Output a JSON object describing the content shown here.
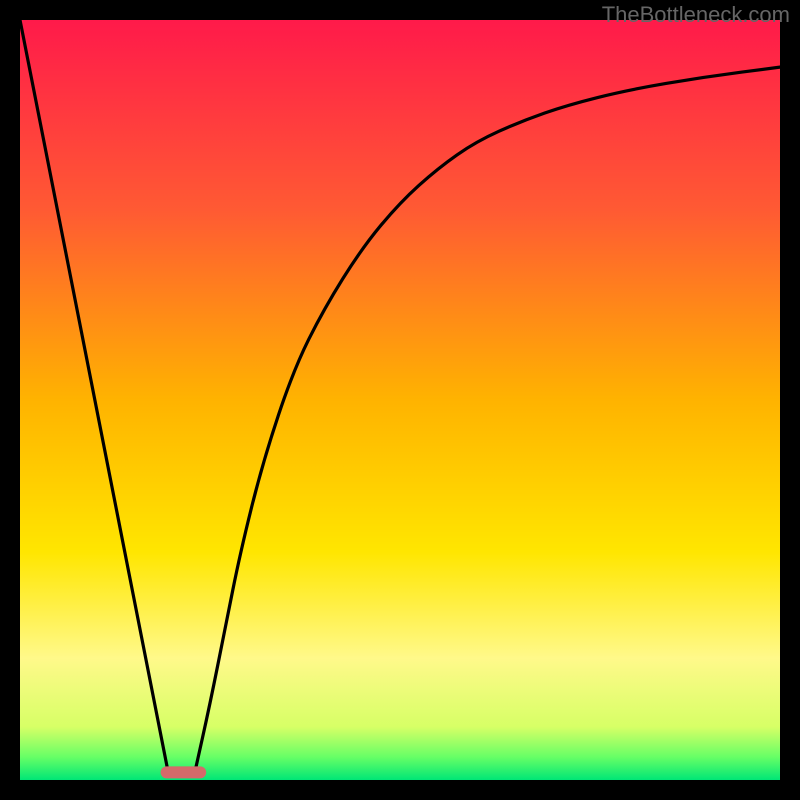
{
  "watermark": "TheBottleneck.com",
  "chart_data": {
    "type": "line",
    "title": "",
    "xlabel": "",
    "ylabel": "",
    "xlim": [
      0,
      100
    ],
    "ylim": [
      0,
      100
    ],
    "background_gradient": {
      "stops": [
        {
          "offset": 0,
          "color": "#ff1a4a"
        },
        {
          "offset": 25,
          "color": "#ff5a33"
        },
        {
          "offset": 50,
          "color": "#ffb300"
        },
        {
          "offset": 70,
          "color": "#ffe600"
        },
        {
          "offset": 84,
          "color": "#fff98a"
        },
        {
          "offset": 93,
          "color": "#d7ff66"
        },
        {
          "offset": 97,
          "color": "#66ff66"
        },
        {
          "offset": 100,
          "color": "#00e676"
        }
      ]
    },
    "series": [
      {
        "name": "left-edge-line",
        "x": [
          0,
          19.5
        ],
        "y": [
          100,
          1
        ]
      },
      {
        "name": "right-curve",
        "x": [
          23,
          25,
          27,
          29,
          32,
          36,
          40,
          45,
          50,
          55,
          60,
          66,
          72,
          80,
          90,
          100
        ],
        "y": [
          1,
          10,
          20,
          30,
          42,
          54,
          62,
          70,
          76,
          80.5,
          84,
          86.7,
          88.8,
          90.8,
          92.5,
          93.8
        ]
      }
    ],
    "marker": {
      "name": "min-marker",
      "x_center": 21.5,
      "y": 1,
      "width": 6,
      "color": "#d46a6a"
    }
  }
}
